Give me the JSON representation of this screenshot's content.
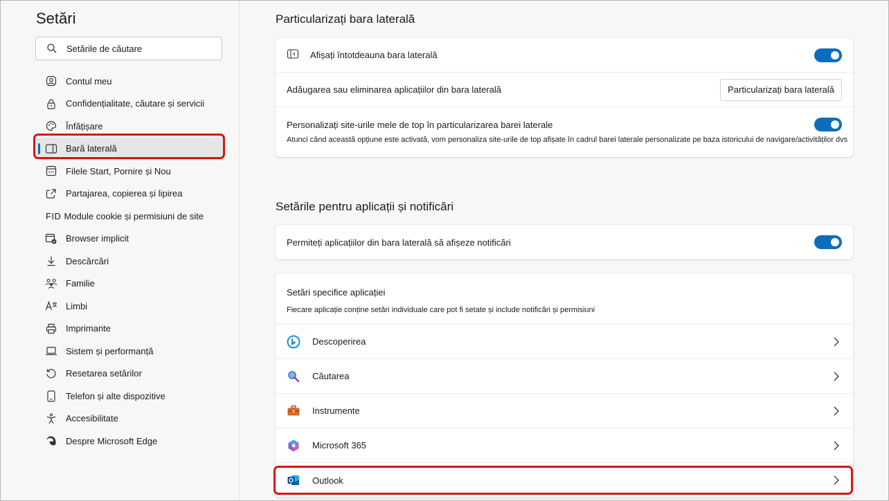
{
  "sidebar": {
    "title": "Setări",
    "search_placeholder": "Setările de căutare",
    "items": [
      {
        "label": "Contul meu",
        "icon": "account-icon"
      },
      {
        "label": "Confidențialitate, căutare și servicii",
        "icon": "lock-icon"
      },
      {
        "label": "Înfățișare",
        "icon": "palette-icon"
      },
      {
        "label": "Bară laterală",
        "icon": "sidebar-icon"
      },
      {
        "label": "Filele Start, Pornire și Nou",
        "icon": "start-page-icon"
      },
      {
        "label": "Partajarea, copierea și lipirea",
        "icon": "share-icon"
      },
      {
        "label": "Module cookie și permisiuni de site",
        "prefix": "FID",
        "icon": "fid-text"
      },
      {
        "label": "Browser implicit",
        "icon": "default-browser-icon"
      },
      {
        "label": "Descărcări",
        "icon": "download-icon"
      },
      {
        "label": "Familie",
        "icon": "family-icon"
      },
      {
        "label": "Limbi",
        "icon": "language-icon"
      },
      {
        "label": "Imprimante",
        "icon": "printer-icon"
      },
      {
        "label": "Sistem și performanță",
        "icon": "laptop-icon"
      },
      {
        "label": "Resetarea setărilor",
        "icon": "reset-icon"
      },
      {
        "label": "Telefon și alte dispozitive",
        "icon": "phone-icon"
      },
      {
        "label": "Accesibilitate",
        "icon": "accessibility-icon"
      },
      {
        "label": "Despre Microsoft Edge",
        "icon": "edge-icon"
      }
    ]
  },
  "main": {
    "section1": {
      "title": "Particularizați bara laterală",
      "always_show_label": "Afișați întotdeauna bara laterală",
      "always_show_on": true,
      "add_remove_label": "Adăugarea sau eliminarea aplicațiilor din bara laterală",
      "customize_button": "Particularizați bara laterală",
      "personalize_label": "Personalizați site-urile mele de top în particularizarea barei laterale",
      "personalize_desc": "Atunci când această opțiune este activată, vom personaliza site-urile de top afișate în cadrul barei laterale personalizate pe baza istoricului de navigare/activităților dvs",
      "personalize_on": true
    },
    "section2": {
      "title": "Setările pentru aplicații și notificări",
      "notify_label": "Permiteți aplicațiilor din bara laterală să afișeze notificări",
      "notify_on": true,
      "app_settings_title": "Setări specifice aplicației",
      "app_settings_desc": "Fiecare aplicație conține setări individuale care pot fi setate și include notificări și permisiuni",
      "apps": [
        {
          "label": "Descoperirea",
          "icon": "bing-discover-icon"
        },
        {
          "label": "Căutarea",
          "icon": "search-magnifier-icon"
        },
        {
          "label": "Instrumente",
          "icon": "toolbox-icon"
        },
        {
          "label": "Microsoft 365",
          "icon": "microsoft-365-icon"
        },
        {
          "label": "Outlook",
          "icon": "outlook-icon"
        }
      ]
    }
  },
  "colors": {
    "accent": "#0f6cbd",
    "highlight": "#d81414"
  }
}
